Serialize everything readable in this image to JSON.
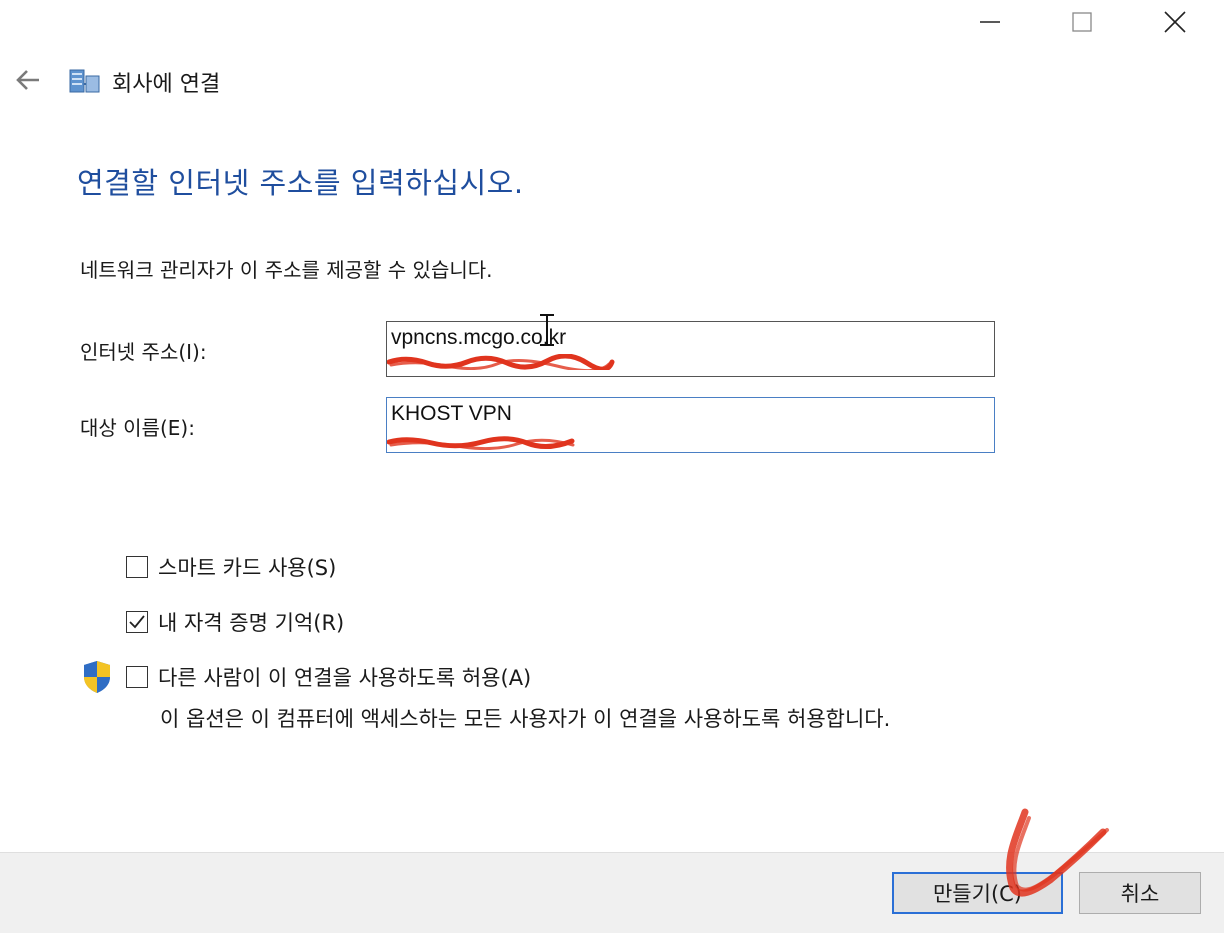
{
  "window": {
    "title": "회사에 연결",
    "controls": {
      "minimize": "minimize-icon",
      "maximize": "maximize-icon",
      "close": "close-icon"
    }
  },
  "nav": {
    "back_icon": "back-arrow-icon",
    "app_icon": "vpn-network-icon"
  },
  "heading": "연결할 인터넷 주소를 입력하십시오.",
  "description": "네트워크 관리자가 이 주소를 제공할 수 있습니다.",
  "fields": {
    "address": {
      "label": "인터넷 주소(I):",
      "value": "vpncns.mcgo.co.kr"
    },
    "name": {
      "label": "대상 이름(E):",
      "value": "KHOST VPN"
    }
  },
  "options": {
    "smart_card": {
      "label": "스마트 카드 사용(S)",
      "checked": false
    },
    "remember_credentials": {
      "label": "내 자격 증명 기억(R)",
      "checked": true
    },
    "allow_others": {
      "label": "다른 사람이 이 연결을 사용하도록 허용(A)",
      "checked": false,
      "description": "이 옵션은 이 컴퓨터에 액세스하는 모든 사용자가 이 연결을 사용하도록 허용합니다."
    }
  },
  "buttons": {
    "create": "만들기(C)",
    "cancel": "취소"
  },
  "colors": {
    "heading": "#1f4e9e",
    "focus_border": "#2a6fd6",
    "annotation": "#e0341e",
    "footer": "#f0f0f0"
  }
}
